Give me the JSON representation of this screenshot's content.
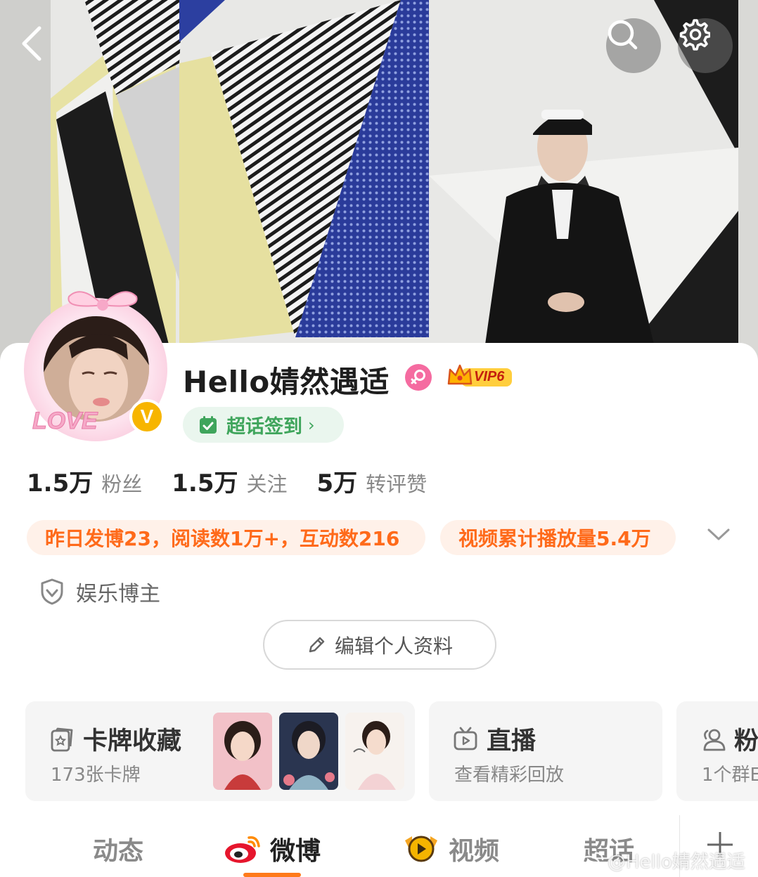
{
  "header": {
    "back_icon": "chevron-left-icon",
    "search_icon": "search-icon",
    "settings_icon": "gear-icon"
  },
  "profile": {
    "username": "Hello婧然遇适",
    "gender_icon": "female-icon",
    "vip_label": "VIP6",
    "avatar_frame_text": "LOVE",
    "verified_mark": "V",
    "checkin_label": "超话签到",
    "checkin_chevron": "›"
  },
  "stats": [
    {
      "value": "1.5万",
      "label": "粉丝"
    },
    {
      "value": "1.5万",
      "label": "关注"
    },
    {
      "value": "5万",
      "label": "转评赞"
    }
  ],
  "highlights": [
    "昨日发博23，阅读数1万+，互动数216",
    "视频累计播放量5.4万"
  ],
  "tag": {
    "label": "娱乐博主",
    "icon": "shield-icon"
  },
  "edit_profile_label": "编辑个人资料",
  "tiles": [
    {
      "title": "卡牌收藏",
      "subtitle": "173张卡牌",
      "icon": "card-icon"
    },
    {
      "title": "直播",
      "subtitle": "查看精彩回放",
      "icon": "tv-icon"
    },
    {
      "title": "粉",
      "subtitle": "1个群E",
      "icon": "users-icon"
    }
  ],
  "tabs": [
    {
      "label": "动态",
      "active": false
    },
    {
      "label": "微博",
      "active": true
    },
    {
      "label": "视频",
      "active": false
    },
    {
      "label": "超话",
      "active": false
    }
  ],
  "watermark": "@Hello婧然遇适",
  "colors": {
    "accent_orange": "#ff7a1a",
    "highlight_text": "#ff6a1a",
    "highlight_bg": "#fff1e9",
    "checkin_green": "#3fa55c",
    "vip_gold": "#f7b500",
    "gender_pink": "#f56ba0"
  }
}
